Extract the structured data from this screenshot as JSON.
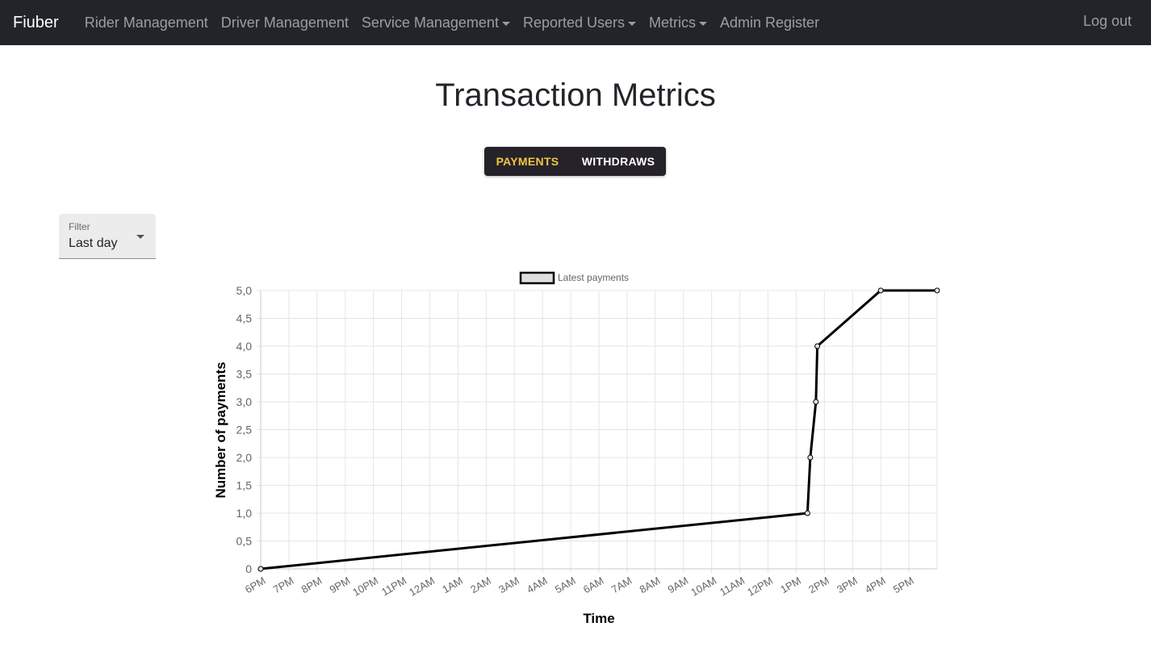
{
  "nav": {
    "brand": "Fiuber",
    "items": [
      {
        "label": "Rider Management",
        "dropdown": false
      },
      {
        "label": "Driver Management",
        "dropdown": false
      },
      {
        "label": "Service Management",
        "dropdown": true
      },
      {
        "label": "Reported Users",
        "dropdown": true
      },
      {
        "label": "Metrics",
        "dropdown": true
      },
      {
        "label": "Admin Register",
        "dropdown": false
      }
    ],
    "logout": "Log out"
  },
  "page": {
    "title": "Transaction Metrics"
  },
  "tabs": {
    "payments": "PAYMENTS",
    "withdraws": "WITHDRAWS",
    "active": "payments",
    "active_color": "#f5c443",
    "inactive_color": "#ffffff"
  },
  "filter": {
    "label": "Filter",
    "value": "Last day"
  },
  "chart_data": {
    "type": "line",
    "series": [
      {
        "name": "Latest payments",
        "color": "#000000",
        "fill": "#e0e0e0",
        "points": [
          {
            "x": 18.0,
            "y": 0
          },
          {
            "x": 37.4,
            "y": 1
          },
          {
            "x": 37.5,
            "y": 2
          },
          {
            "x": 37.7,
            "y": 3
          },
          {
            "x": 37.75,
            "y": 4
          },
          {
            "x": 40.0,
            "y": 5
          },
          {
            "x": 42.0,
            "y": 5
          }
        ]
      }
    ],
    "x_tick_labels": [
      "6PM",
      "7PM",
      "8PM",
      "9PM",
      "10PM",
      "11PM",
      "12AM",
      "1AM",
      "2AM",
      "3AM",
      "4AM",
      "5AM",
      "6AM",
      "7AM",
      "8AM",
      "9AM",
      "10AM",
      "11AM",
      "12PM",
      "1PM",
      "2PM",
      "3PM",
      "4PM",
      "5PM"
    ],
    "x_tick_values": [
      18,
      19,
      20,
      21,
      22,
      23,
      24,
      25,
      26,
      27,
      28,
      29,
      30,
      31,
      32,
      33,
      34,
      35,
      36,
      37,
      38,
      39,
      40,
      41
    ],
    "xlim": [
      18,
      42
    ],
    "y_tick_labels": [
      "0",
      "0,5",
      "1,0",
      "1,5",
      "2,0",
      "2,5",
      "3,0",
      "3,5",
      "4,0",
      "4,5",
      "5,0"
    ],
    "y_tick_values": [
      0,
      0.5,
      1,
      1.5,
      2,
      2.5,
      3,
      3.5,
      4,
      4.5,
      5
    ],
    "ylim": [
      0,
      5
    ],
    "xlabel": "Time",
    "ylabel": "Number of payments",
    "grid": true,
    "legend_position": "top-center"
  }
}
